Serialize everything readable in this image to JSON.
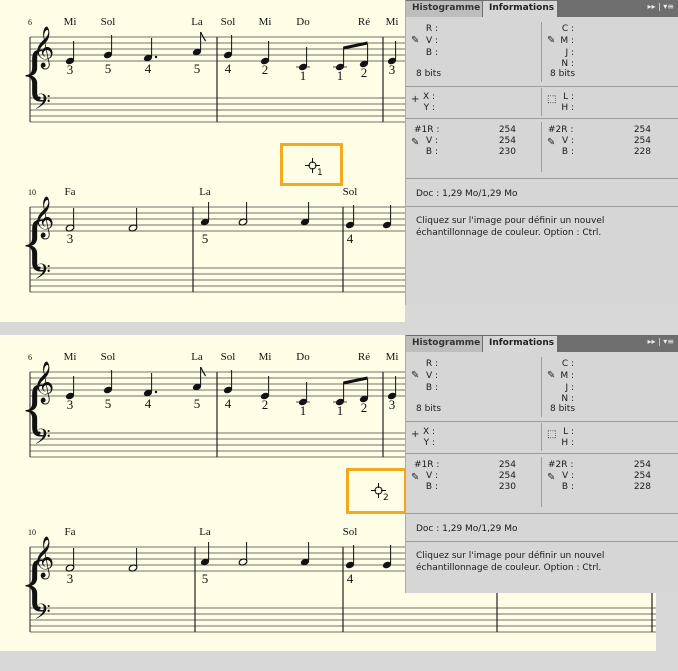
{
  "panel": {
    "tabs": [
      {
        "label": "Histogramme",
        "active": false
      },
      {
        "label": "Informations",
        "active": true
      }
    ],
    "menu_icons": "▸▸ | ▾≡",
    "rgb_labels": [
      "R :",
      "V :",
      "B :"
    ],
    "cmyk_labels": [
      "C :",
      "M :",
      "J :",
      "N :"
    ],
    "bits_left": "8 bits",
    "bits_right": "8 bits",
    "xy_labels": [
      "X :",
      "Y :"
    ],
    "lh_labels": [
      "L :",
      "H :"
    ],
    "sampler1": {
      "labels": [
        "#1R :",
        "V :",
        "B :"
      ],
      "values": [
        "254",
        "254",
        "230"
      ]
    },
    "sampler2": {
      "labels": [
        "#2R :",
        "V :",
        "B :"
      ],
      "values": [
        "254",
        "254",
        "228"
      ]
    },
    "doc": "Doc : 1,29 Mo/1,29 Mo",
    "help_line1": "Cliquez sur l'image pour définir un nouvel",
    "help_line2": "échantillonnage de couleur. Option : Ctrl."
  },
  "score": {
    "system1": {
      "measure_number": "6",
      "notes": [
        {
          "pitch": "E4",
          "dur": "q",
          "name": "Mi",
          "finger": "3"
        },
        {
          "pitch": "G4",
          "dur": "q",
          "name": "Sol",
          "finger": "5"
        },
        {
          "pitch": "F4",
          "dur": "q.",
          "name": "",
          "finger": "4"
        },
        {
          "pitch": "A4",
          "dur": "8",
          "name": "La",
          "finger": "5"
        },
        {
          "pitch": "G4",
          "dur": "q",
          "name": "Sol",
          "finger": "4"
        },
        {
          "pitch": "E4",
          "dur": "q",
          "name": "Mi",
          "finger": "2"
        },
        {
          "pitch": "C4",
          "dur": "q",
          "name": "Do",
          "finger": "1"
        },
        {
          "pitch": "C4",
          "dur": "8b",
          "name": "",
          "finger": "1"
        },
        {
          "pitch": "D4",
          "dur": "8b",
          "name": "Ré",
          "finger": "2"
        },
        {
          "pitch": "E4",
          "dur": "q",
          "name": "Mi",
          "finger": "3"
        }
      ]
    },
    "system2": {
      "measure_number": "10",
      "notes": [
        {
          "pitch": "F4",
          "dur": "h",
          "name": "Fa",
          "finger": "3"
        },
        {
          "pitch": "F4",
          "dur": "h",
          "name": "",
          "finger": ""
        },
        {
          "pitch": "A4",
          "dur": "q",
          "name": "La",
          "finger": "5"
        },
        {
          "pitch": "A4",
          "dur": "h",
          "name": "",
          "finger": ""
        },
        {
          "pitch": "A4",
          "dur": "q",
          "name": "",
          "finger": ""
        },
        {
          "pitch": "G4",
          "dur": "q",
          "name": "Sol",
          "finger": "4"
        },
        {
          "pitch": "G4",
          "dur": "q",
          "name": "",
          "finger": ""
        }
      ]
    }
  },
  "samplers": [
    {
      "label": "1"
    },
    {
      "label": "2"
    }
  ],
  "colors": {
    "paper": "#fefee6",
    "highlight": "#f2a91e",
    "panel": "#d6d6d6"
  }
}
